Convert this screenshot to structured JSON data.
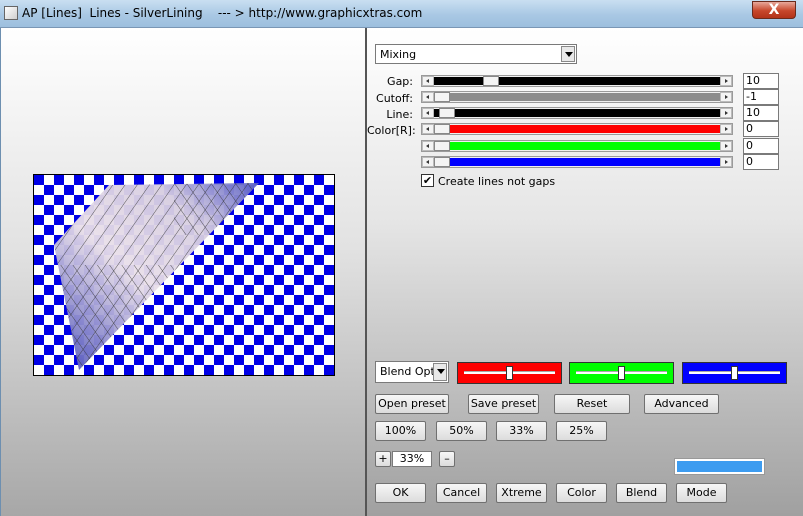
{
  "window": {
    "title": "AP [Lines]  Lines - SilverLining    --- > http://www.graphicxtras.com",
    "close_label": "X"
  },
  "mode_dropdown": {
    "value": "Mixing"
  },
  "params": [
    {
      "label": "Gap:",
      "value": "10",
      "fill_color": "#000000",
      "level": 0.18
    },
    {
      "label": "Cutoff:",
      "value": "-1",
      "fill_color": "#8c8c8c",
      "level": 0.0
    },
    {
      "label": "Line:",
      "value": "10",
      "fill_color": "#000000",
      "level": 0.02
    },
    {
      "label": "Color[R]:",
      "value": "0",
      "fill_color": "#ff0000",
      "level": 0.0
    },
    {
      "label": "",
      "value": "0",
      "fill_color": "#00ff00",
      "level": 0.0
    },
    {
      "label": "",
      "value": "0",
      "fill_color": "#0000ff",
      "level": 0.0
    }
  ],
  "create_lines": {
    "label": "Create lines not gaps",
    "checked": true,
    "mark": "✔"
  },
  "blend_dropdown": {
    "value": "Blend Optio"
  },
  "blend_sliders": [
    {
      "color": "#ff0000",
      "level": 0.5
    },
    {
      "color": "#00ff00",
      "level": 0.5
    },
    {
      "color": "#0000ff",
      "level": 0.5
    }
  ],
  "buttons": {
    "open_preset": "Open preset",
    "save_preset": "Save preset",
    "reset": "Reset",
    "advanced": "Advanced",
    "zoom_100": "100%",
    "zoom_50": "50%",
    "zoom_33": "33%",
    "zoom_25": "25%",
    "ok": "OK",
    "cancel": "Cancel",
    "xtreme": "Xtreme",
    "color": "Color",
    "blend": "Blend",
    "mode": "Mode"
  },
  "zoom": {
    "plus": "+",
    "value": "33%",
    "minus": "–"
  },
  "swatch_color": "#3d9cf0"
}
